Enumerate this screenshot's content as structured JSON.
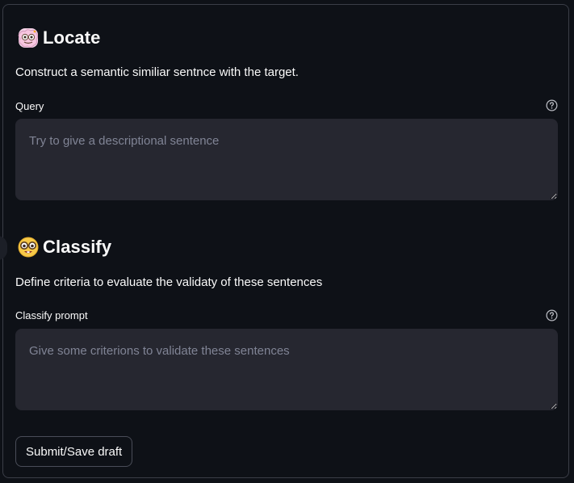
{
  "locate": {
    "title": "Locate",
    "emoji_icon": "sparkle-brain-emoji-icon",
    "description": "Construct a semantic similiar sentnce with the target.",
    "field_label": "Query",
    "placeholder": "Try to give a descriptional sentence",
    "value": ""
  },
  "classify": {
    "title": "Classify",
    "emoji_icon": "nerd-face-emoji-icon",
    "description": "Define criteria to evaluate the validaty of these sentences",
    "field_label": "Classify prompt",
    "placeholder": "Give some criterions to validate these sentences",
    "value": ""
  },
  "actions": {
    "submit_label": "Submit/Save draft"
  },
  "colors": {
    "background": "#0e1117",
    "input_bg": "#262730",
    "text": "#fafafa",
    "placeholder": "#808495",
    "border": "#3a3d47"
  }
}
